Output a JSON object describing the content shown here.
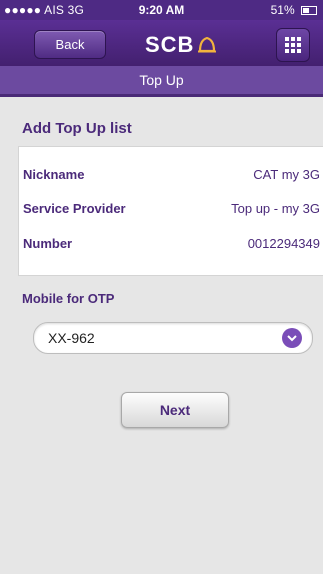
{
  "status_bar": {
    "carrier": "●●●●● AIS  3G",
    "time": "9:20 AM",
    "battery": "51%"
  },
  "header": {
    "back_label": "Back",
    "brand": "SCB",
    "page_title": "Top Up"
  },
  "section": {
    "title": "Add Top Up list"
  },
  "details": [
    {
      "label": "Nickname",
      "value": "CAT my 3G"
    },
    {
      "label": "Service Provider",
      "value": "Top up - my 3G"
    },
    {
      "label": "Number",
      "value": "0012294349"
    }
  ],
  "otp": {
    "label": "Mobile for OTP",
    "selected": "XX-962"
  },
  "actions": {
    "next_label": "Next"
  },
  "colors": {
    "brand_purple": "#4e2a84",
    "accent_gold": "#f2b33d",
    "text_purple": "#4b2a7a"
  }
}
